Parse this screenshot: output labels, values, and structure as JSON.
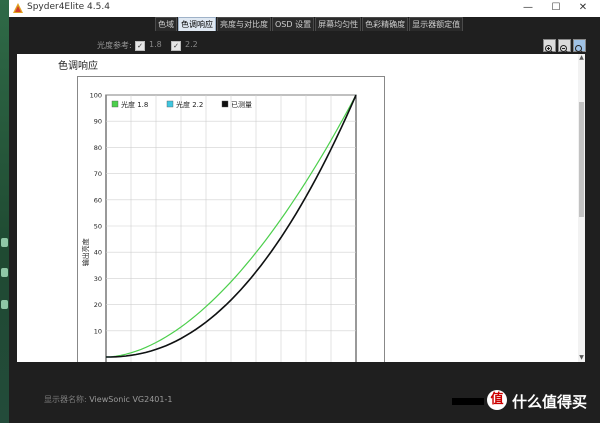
{
  "window": {
    "title": "Spyder4Elite 4.5.4",
    "controls": {
      "minimize": "—",
      "maximize": "☐",
      "close": "✕"
    }
  },
  "tabs": [
    {
      "label": "色域",
      "active": false
    },
    {
      "label": "色调响应",
      "active": true
    },
    {
      "label": "亮度与对比度",
      "active": false
    },
    {
      "label": "OSD 设置",
      "active": false
    },
    {
      "label": "屏幕均匀性",
      "active": false
    },
    {
      "label": "色彩精确度",
      "active": false
    },
    {
      "label": "显示器额定值",
      "active": false
    }
  ],
  "toolbar": {
    "gamma_ref_label": "光度参考:",
    "options": [
      {
        "label": "1.8",
        "checked": true
      },
      {
        "label": "2.2",
        "checked": true
      }
    ],
    "zoom_buttons": [
      "zoom-in-icon",
      "zoom-out-icon",
      "zoom-fit-icon"
    ]
  },
  "panel": {
    "title": "色调响应"
  },
  "chart_data": {
    "type": "line",
    "title": "",
    "xlabel": "",
    "ylabel": "输出亮度",
    "xlim": [
      0,
      100
    ],
    "ylim": [
      0,
      100
    ],
    "yticks": [
      10,
      20,
      30,
      40,
      50,
      60,
      70,
      80,
      90,
      100
    ],
    "grid": true,
    "legend": "top-left",
    "series": [
      {
        "name": "光度 1.8",
        "color": "#4ccf4c",
        "gamma": 1.8,
        "x": [
          0,
          10,
          20,
          30,
          40,
          50,
          60,
          70,
          80,
          90,
          100
        ],
        "y": [
          0,
          1.6,
          5.5,
          11.5,
          19.2,
          28.7,
          39.9,
          52.6,
          66.9,
          82.7,
          100
        ]
      },
      {
        "name": "光度 2.2",
        "color": "#3fc6e0",
        "gamma": 2.2,
        "x": [
          0,
          10,
          20,
          30,
          40,
          50,
          60,
          70,
          80,
          90,
          100
        ],
        "y": [
          0,
          0.6,
          2.9,
          7.1,
          13.3,
          21.8,
          32.5,
          45.6,
          61.2,
          79.3,
          100
        ]
      },
      {
        "name": "已测量",
        "color": "#111111",
        "gamma": 2.2,
        "x": [
          0,
          10,
          20,
          30,
          40,
          50,
          60,
          70,
          80,
          90,
          100
        ],
        "y": [
          0,
          0.6,
          2.9,
          7.1,
          13.3,
          21.8,
          32.5,
          45.6,
          61.2,
          79.3,
          100
        ]
      }
    ]
  },
  "footer": {
    "display_name_label": "显示器名称:",
    "display_name_value": "ViewSonic VG2401-1"
  },
  "watermark": {
    "icon_text": "值",
    "text": "什么值得买"
  },
  "colors": {
    "accent_tab": "#dfe8f2",
    "window_bg": "#1f1f1f",
    "panel_bg": "#ffffff"
  }
}
